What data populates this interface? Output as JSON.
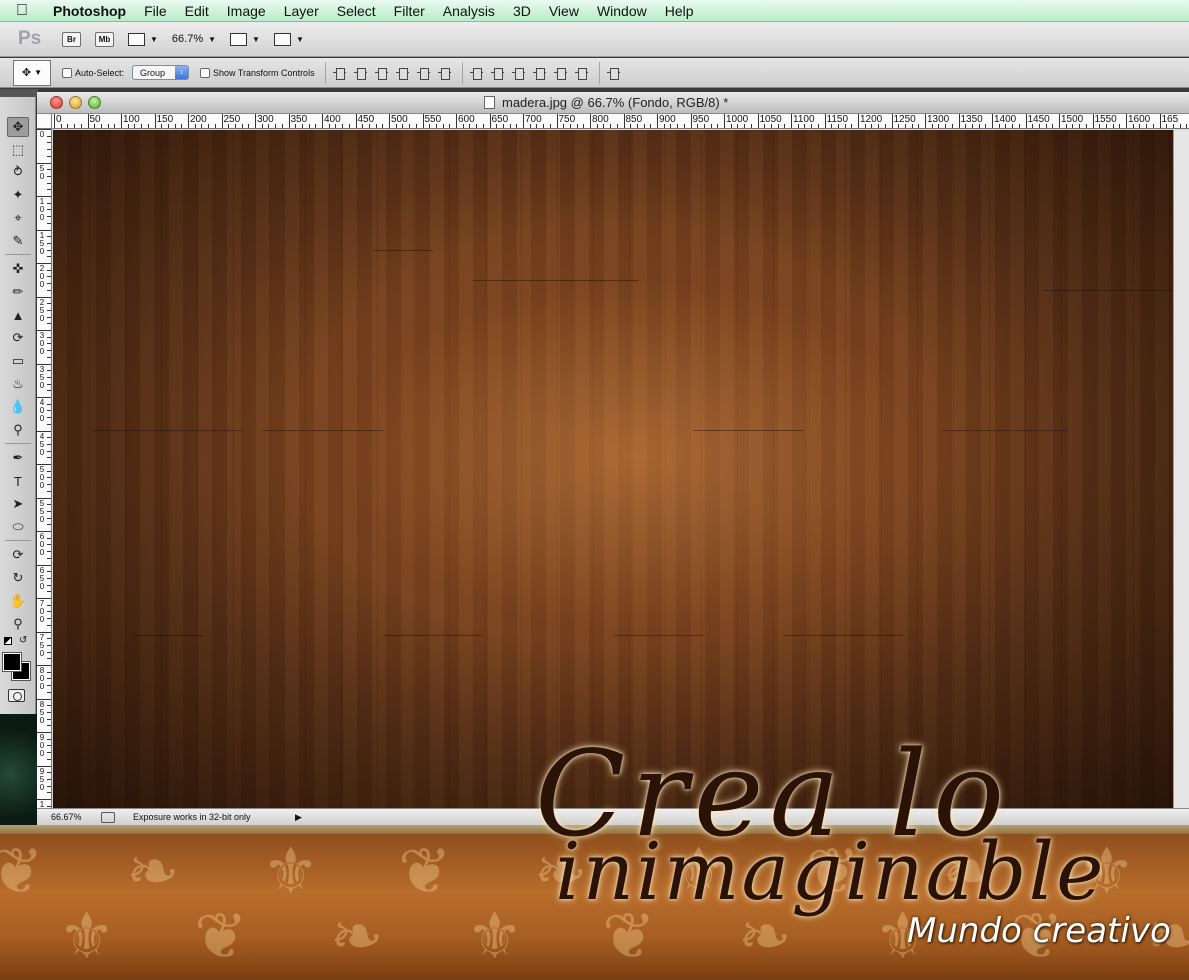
{
  "menubar": {
    "app_name": "Photoshop",
    "items": [
      "File",
      "Edit",
      "Image",
      "Layer",
      "Select",
      "Filter",
      "Analysis",
      "3D",
      "View",
      "Window",
      "Help"
    ]
  },
  "appbar": {
    "logo": "Ps",
    "bridge": "Br",
    "minibridge": "Mb",
    "zoom": "66.7%"
  },
  "options": {
    "auto_select_label": "Auto-Select:",
    "auto_select_value": "Group",
    "transform_label": "Show Transform Controls"
  },
  "document": {
    "title": "madera.jpg @ 66.7% (Fondo, RGB/8) *"
  },
  "rulers": {
    "horizontal": [
      "0",
      "50",
      "100",
      "150",
      "200",
      "250",
      "300",
      "350",
      "400",
      "450",
      "500",
      "550",
      "600",
      "650",
      "700",
      "750",
      "800",
      "850",
      "900",
      "950",
      "1000",
      "1050",
      "1100",
      "1150",
      "1200",
      "1250",
      "1300",
      "1350",
      "1400",
      "1450",
      "1500",
      "1550",
      "1600",
      "165"
    ],
    "vertical": [
      "0",
      "5\n0",
      "1\n0\n0",
      "1\n5\n0",
      "2\n0\n0",
      "2\n5\n0",
      "3\n0\n0",
      "3\n5\n0",
      "4\n0\n0",
      "4\n5\n0",
      "5\n0\n0",
      "5\n5\n0",
      "6\n0\n0",
      "6\n5\n0",
      "7\n0\n0",
      "7\n5\n0",
      "8\n0\n0",
      "8\n5\n0",
      "9\n0\n0",
      "9\n5\n0",
      "1"
    ]
  },
  "statusbar": {
    "zoom": "66.67%",
    "info": "Exposure works in 32-bit only"
  },
  "brand": {
    "line1": "Crea lo",
    "line2": "inimaginable",
    "tagline": "Mundo creativo"
  },
  "colors": {
    "foreground": "#000000",
    "background": "#000000",
    "wood": "#6a3a1b"
  }
}
